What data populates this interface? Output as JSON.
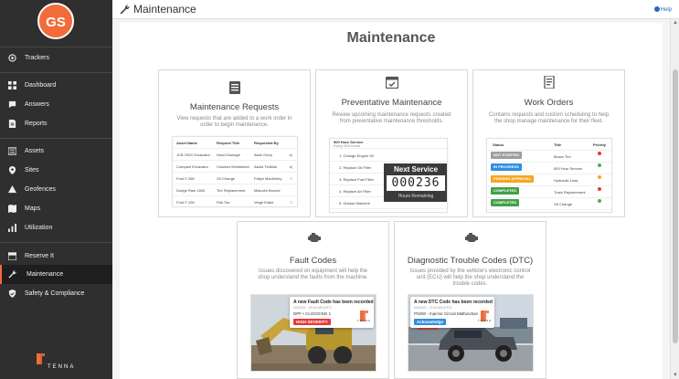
{
  "user": {
    "initials": "GS"
  },
  "sidebar": {
    "items": [
      {
        "label": "Trackers",
        "icon": "tracker-icon"
      },
      {
        "label": "Dashboard",
        "icon": "dashboard-icon"
      },
      {
        "label": "Answers",
        "icon": "answers-icon"
      },
      {
        "label": "Reports",
        "icon": "reports-icon"
      },
      {
        "label": "Assets",
        "icon": "assets-icon"
      },
      {
        "label": "Sites",
        "icon": "location-pin-icon"
      },
      {
        "label": "Geofences",
        "icon": "geofence-icon"
      },
      {
        "label": "Maps",
        "icon": "map-icon"
      },
      {
        "label": "Utilization",
        "icon": "utilization-icon"
      },
      {
        "label": "Reserve It",
        "icon": "calendar-icon"
      },
      {
        "label": "Maintenance",
        "icon": "wrench-icon",
        "active": true
      },
      {
        "label": "Safety & Compliance",
        "icon": "shield-icon"
      }
    ],
    "logo_text": "TENNA"
  },
  "header": {
    "title": "Maintenance",
    "help_label": "Help"
  },
  "page": {
    "title": "Maintenance"
  },
  "cards": {
    "requests": {
      "title": "Maintenance Requests",
      "description": "View requests that are added to a work order in order to begin maintenance.",
      "table": {
        "headers": [
          "Asset Name",
          "Request Title",
          "Requested By"
        ],
        "rows": [
          [
            "JCB 220X Excavator",
            "Hood Damage",
            "Alain Gurry"
          ],
          [
            "Compact Excavator",
            "Cracked Windshield",
            "Aland Timbink"
          ],
          [
            "Ford F-350",
            "Oil Change",
            "Felipe MacKinley"
          ],
          [
            "Dodge Ram 1500",
            "Tire Replacement",
            "Malcolm Bochof"
          ],
          [
            "Ford F-150",
            "Flat Tire",
            "Vergil Eddie"
          ]
        ]
      }
    },
    "preventative": {
      "title": "Preventative Maintenance",
      "description": "Review upcoming maintenance requests created from preventative maintenance thresholds.",
      "list_title": "500 Hour Service",
      "list_subtitle": "Every 500 hours",
      "items": [
        "1. Change Engine Oil",
        "2. Replace Oil Filter",
        "3. Replace Fuel Filter",
        "4. Replace Air Filter",
        "5. Grease Machine"
      ],
      "next_service": {
        "title": "Next Service",
        "counter": "000236",
        "subtitle": "Hours Remaining"
      }
    },
    "work_orders": {
      "title": "Work Orders",
      "description": "Contains requests and custom scheduling to help the shop manage maintenance for their fleet.",
      "headers": [
        "Status",
        "Title",
        "Priority"
      ],
      "rows": [
        {
          "status": "NOT STARTED",
          "status_color": "#9e9e9e",
          "title": "Blown Tire",
          "priority_color": "#e53935"
        },
        {
          "status": "IN PROGRESS",
          "status_color": "#2f8fe0",
          "title": "500 Hour Service",
          "priority_color": "#4caf50"
        },
        {
          "status": "PENDING APPROVAL",
          "status_color": "#f5a623",
          "title": "Hydraulic Leak",
          "priority_color": "#f5a623"
        },
        {
          "status": "COMPLETED",
          "status_color": "#43a047",
          "title": "Track Replacement",
          "priority_color": "#e53935"
        },
        {
          "status": "COMPLETED",
          "status_color": "#43a047",
          "title": "Oil Change",
          "priority_color": "#4caf50"
        }
      ]
    },
    "fault_codes": {
      "title": "Fault Codes",
      "description": "Issues discovered on equipment will help the shop understand the faults from the machine.",
      "notice": {
        "title": "A new Fault Code has been recorded",
        "time": "05/26/21 · 09:16 AM (EST)",
        "line": "DPF • CLOGGING 1",
        "button": "HIGH SEVERITY",
        "button_color": "#e53935",
        "logo": "TENNA"
      }
    },
    "dtc": {
      "title": "Diagnostic Trouble Codes (DTC)",
      "description": "Issues provided by the vehicle's electronic control unit (ECU) will help the shop understand the trouble codes.",
      "notice": {
        "title": "A new DTC Code has been recorded",
        "time": "05/26/21 · 11:04 AM (EST)",
        "line": "P0200 - Injector Circuit Malfunction",
        "button": "Acknowledge",
        "button_color": "#2f8fe0",
        "logo": "TENNA"
      }
    }
  },
  "colors": {
    "accent": "#f26b3a",
    "sidebar_bg": "#2f2f2f",
    "link": "#2b67c4"
  }
}
